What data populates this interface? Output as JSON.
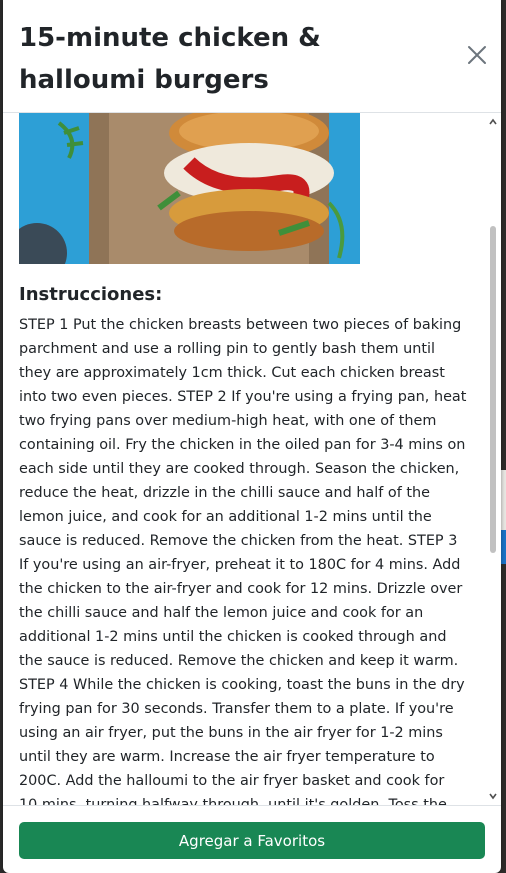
{
  "modal": {
    "title": "15-minute chicken & halloumi burgers",
    "close_icon": "close-icon"
  },
  "body": {
    "image_alt": "chicken and halloumi burger on a wooden board",
    "section_title": "Instrucciones:",
    "instructions": "STEP 1 Put the chicken breasts between two pieces of baking parchment and use a rolling pin to gently bash them until they are approximately 1cm thick. Cut each chicken breast into two even pieces. STEP 2 If you're using a frying pan, heat two frying pans over medium-high heat, with one of them containing oil. Fry the chicken in the oiled pan for 3-4 mins on each side until they are cooked through. Season the chicken, reduce the heat, drizzle in the chilli sauce and half of the lemon juice, and cook for an additional 1-2 mins until the sauce is reduced. Remove the chicken from the heat. STEP 3 If you're using an air-fryer, preheat it to 180C for 4 mins. Add the chicken to the air-fryer and cook for 12 mins. Drizzle over the chilli sauce and half the lemon juice and cook for an additional 1-2 mins until the chicken is cooked through and the sauce is reduced. Remove the chicken and keep it warm. STEP 4 While the chicken is cooking, toast the buns in the dry frying pan for 30 seconds. Transfer them to a plate. If you're using an air fryer, put the buns in the air fryer for 1-2 mins until they are warm. Increase the air fryer temperature to 200C. Add the halloumi to the air fryer basket and cook for 10 mins, turning halfway through, until it's golden. Toss the cabbage with the mayo and the"
  },
  "footer": {
    "favorite_label": "Agregar a Favoritos"
  },
  "colors": {
    "primary_button": "#198754",
    "header_border": "#dee2e6",
    "text": "#212529"
  },
  "scrollbar": {
    "up_icon": "chevron-up-icon",
    "down_icon": "chevron-down-icon"
  }
}
